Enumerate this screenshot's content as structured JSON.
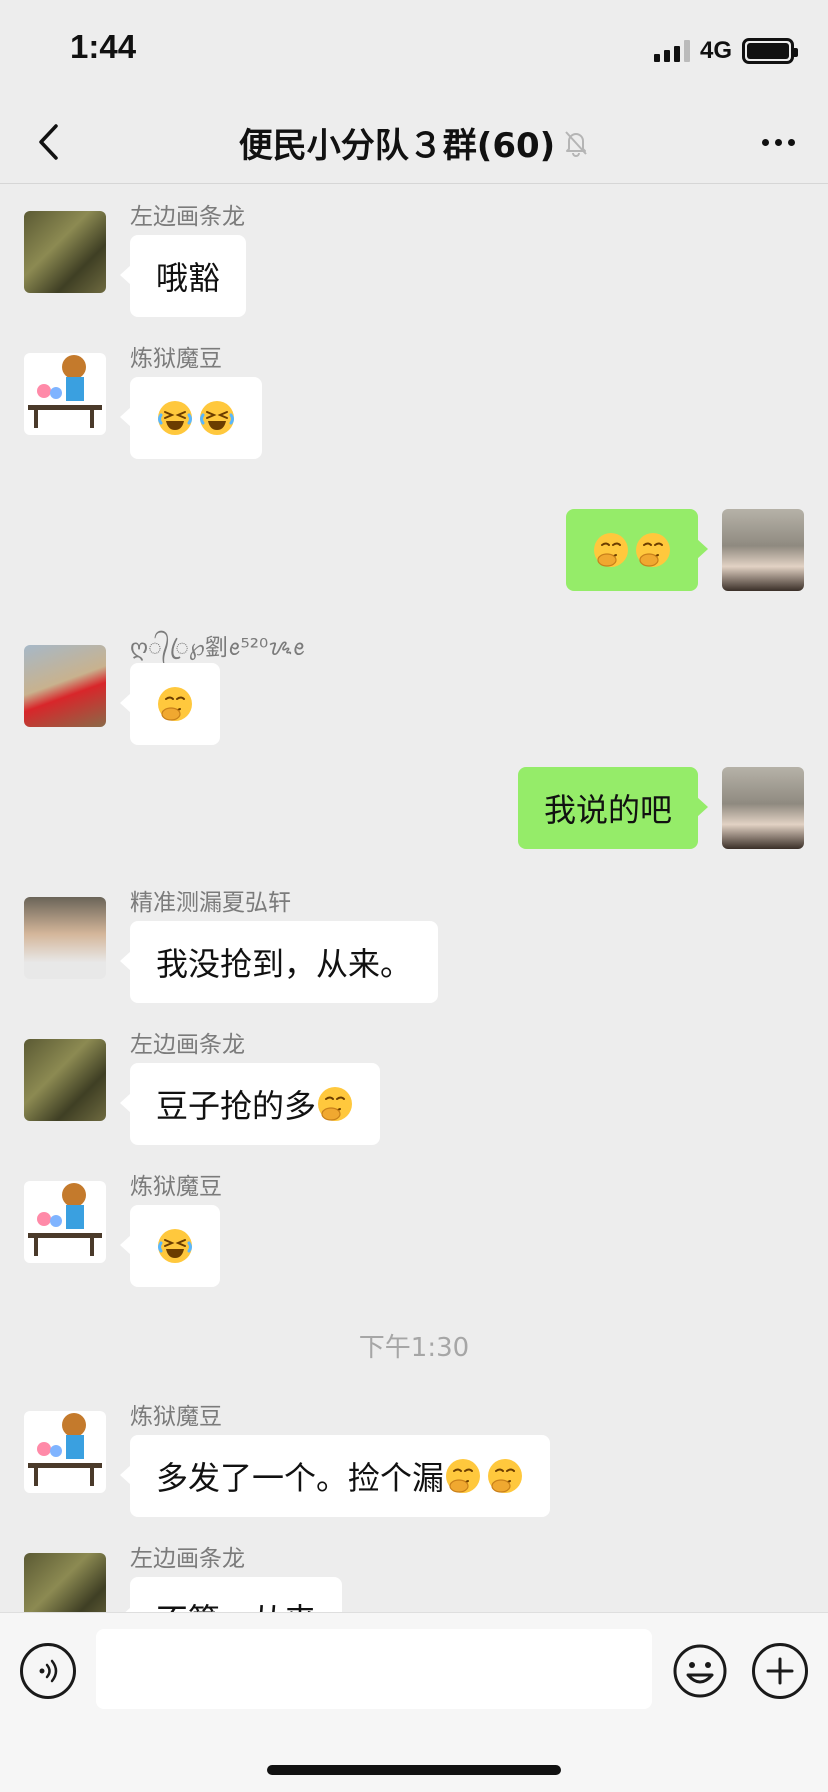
{
  "status_bar": {
    "time": "1:44",
    "network": "4G"
  },
  "nav": {
    "title": "便民小分队３群(60)"
  },
  "messages": [
    {
      "sender": "左边画条龙",
      "text": "哦豁",
      "side": "in",
      "avatar": "camo-soldier"
    },
    {
      "sender": "炼狱魔豆",
      "text": "",
      "emoji": [
        "rolling-laugh-emoji",
        "rolling-laugh-emoji"
      ],
      "side": "in",
      "avatar": "cartoon-girl-bench"
    },
    {
      "sender": "",
      "text": "",
      "emoji": [
        "giggle-emoji",
        "giggle-emoji"
      ],
      "side": "out",
      "avatar": "girl-hood"
    },
    {
      "sender": "ღ᭄ꦿ℘劉ꫀ⁵²⁰ᝰꫀ",
      "text": "",
      "emoji": [
        "giggle-emoji"
      ],
      "side": "in",
      "avatar": "red-coat-person"
    },
    {
      "sender": "",
      "text": "我说的吧",
      "side": "out",
      "avatar": "girl-hood"
    },
    {
      "sender": "精准测漏夏弘轩",
      "text": "我没抢到，从来。",
      "side": "in",
      "avatar": "man-portrait"
    },
    {
      "sender": "左边画条龙",
      "text": "豆子抢的多",
      "emoji": [
        "giggle-emoji"
      ],
      "side": "in",
      "avatar": "camo-soldier"
    },
    {
      "sender": "炼狱魔豆",
      "text": "",
      "emoji": [
        "rolling-laugh-emoji"
      ],
      "side": "in",
      "avatar": "cartoon-girl-bench"
    },
    {
      "sender": "炼狱魔豆",
      "text": "多发了一个。捡个漏",
      "emoji": [
        "giggle-emoji",
        "giggle-emoji"
      ],
      "side": "in",
      "avatar": "cartoon-girl-bench"
    },
    {
      "sender": "左边画条龙",
      "text": "不算，从来",
      "side": "in",
      "avatar": "camo-soldier"
    }
  ],
  "timestamp": "下午1:30",
  "input": {
    "placeholder": ""
  },
  "colors": {
    "background": "#ededed",
    "outgoing_bubble": "#95ec69",
    "incoming_bubble": "#ffffff"
  }
}
